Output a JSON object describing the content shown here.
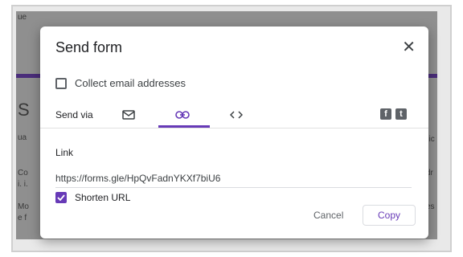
{
  "background": {
    "heading_fragment": "S",
    "fragments": [
      "ue",
      "ua",
      "Co",
      "i. i.",
      "Mo",
      "e f",
      "nic",
      "dr",
      "es"
    ]
  },
  "dialog": {
    "title": "Send form",
    "close_icon": "close-icon",
    "collect_emails_label": "Collect email addresses",
    "send_via_label": "Send via",
    "tabs": [
      {
        "name": "email",
        "icon": "mail-icon",
        "active": false
      },
      {
        "name": "link",
        "icon": "link-icon",
        "active": true
      },
      {
        "name": "embed",
        "icon": "code-icon",
        "active": false
      }
    ],
    "social": {
      "facebook": "f",
      "twitter": "t"
    },
    "link_label": "Link",
    "url": "https://forms.gle/HpQvFadnYKXf7biU6",
    "shorten_label": "Shorten URL",
    "shorten_checked": true,
    "cancel_label": "Cancel",
    "copy_label": "Copy"
  },
  "colors": {
    "accent": "#673ab7",
    "backdrop": "#8f8f8f"
  }
}
